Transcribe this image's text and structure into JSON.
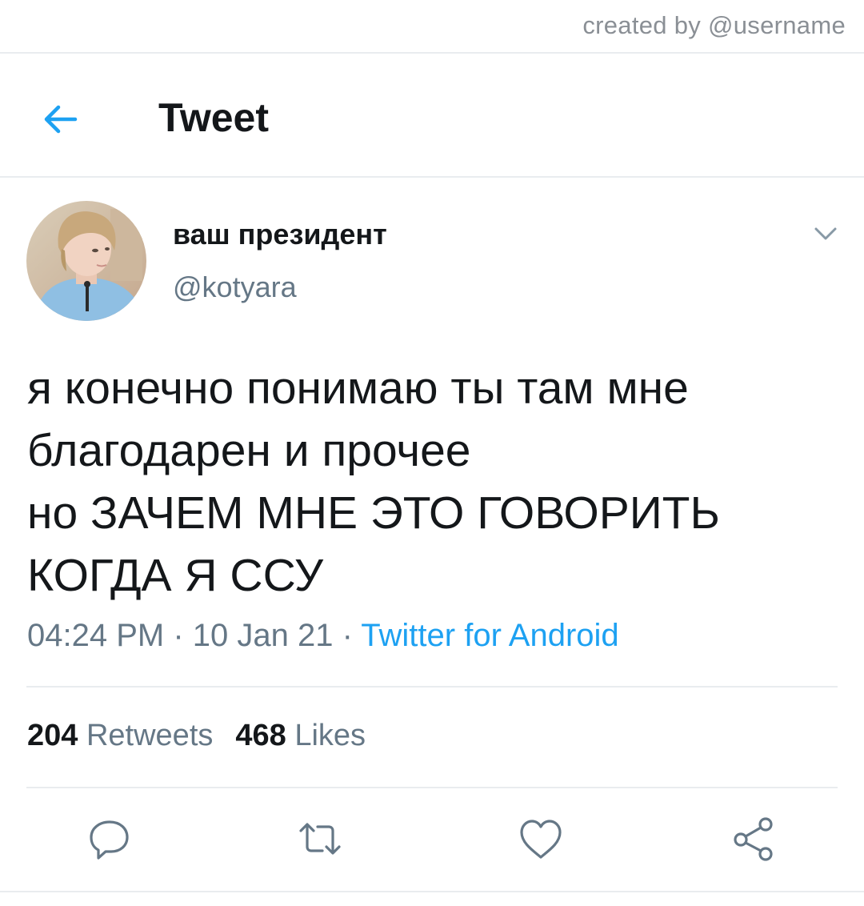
{
  "watermark": "created by @username",
  "header": {
    "title": "Tweet"
  },
  "author": {
    "display_name": "ваш президент",
    "handle": "@kotyara"
  },
  "tweet": {
    "lines": [
      "я конечно понимаю ты там мне",
      "благодарен и прочее",
      "но ЗАЧЕМ МНЕ ЭТО ГОВОРИТЬ",
      "КОГДА Я ССУ"
    ],
    "time": "04:24 PM",
    "date": "10 Jan 21",
    "separator": " · ",
    "source": "Twitter for Android"
  },
  "stats": {
    "retweets_count": "204",
    "retweets_label": "Retweets",
    "likes_count": "468",
    "likes_label": "Likes"
  },
  "icons": {
    "back": "back-arrow-icon",
    "more": "chevron-down-icon",
    "reply": "reply-icon",
    "retweet": "retweet-icon",
    "like": "heart-icon",
    "share": "share-icon"
  },
  "colors": {
    "accent": "#1da1f2",
    "secondary_text": "#657786",
    "primary_text": "#14171a",
    "icon_gray": "#657786",
    "divider": "#e9ecef"
  }
}
